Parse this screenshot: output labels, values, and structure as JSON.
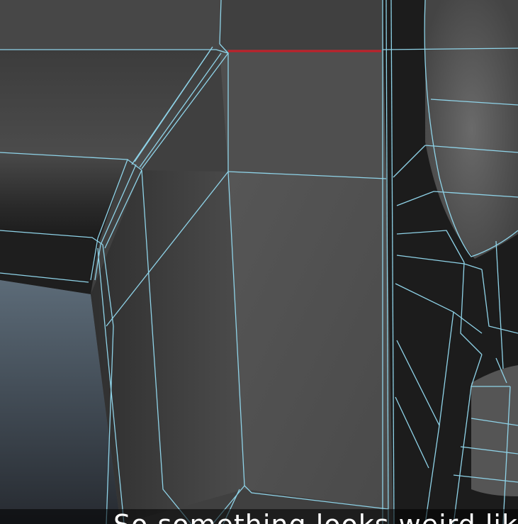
{
  "viewport": {
    "wire_color": "#8fd3e8",
    "selected_edge_color": "#c0202a",
    "background_color": "#3a3a3a"
  },
  "caption": {
    "text": "So something looks weird lik"
  }
}
